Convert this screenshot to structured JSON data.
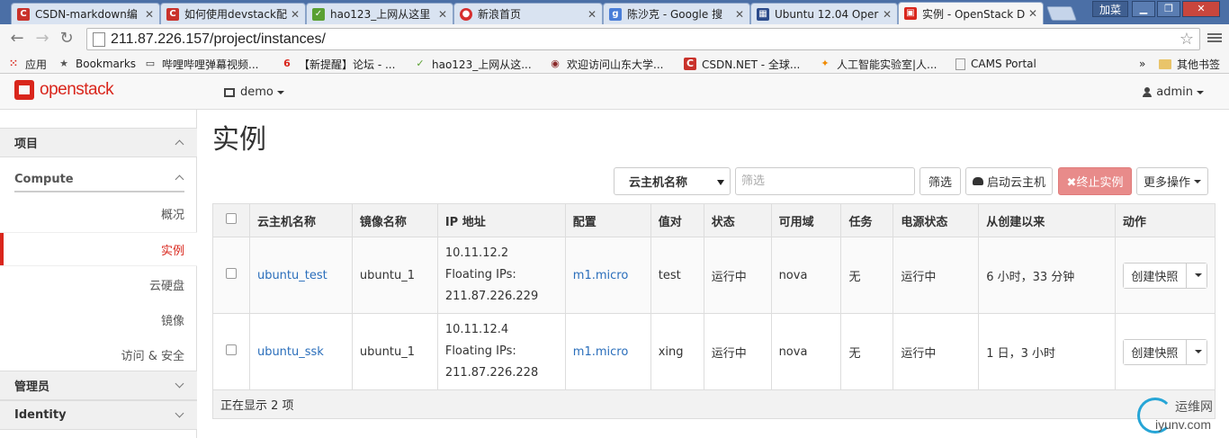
{
  "browser": {
    "tabs": [
      {
        "label": "CSDN-markdown编",
        "icon": "csdn-icon",
        "color": "#c9322b"
      },
      {
        "label": "如何使用devstack配",
        "icon": "csdn-icon",
        "color": "#c9322b"
      },
      {
        "label": "hao123_上网从这里",
        "icon": "hao123-icon",
        "color": "#5aa032"
      },
      {
        "label": "新浪首页",
        "icon": "sina-icon",
        "color": "#d62e2e"
      },
      {
        "label": "陈沙克 - Google 搜",
        "icon": "google-icon",
        "color": "#4a7ed8"
      },
      {
        "label": "Ubuntu 12.04 Oper",
        "icon": "grid-icon",
        "color": "#2b4a8a"
      },
      {
        "label": "实例 - OpenStack D",
        "icon": "openstack-icon",
        "color": "#d9261c"
      }
    ],
    "window_user": "加菜",
    "url": "211.87.226.157/project/instances/",
    "bookmarks": [
      {
        "label": "应用",
        "icon": "apps-icon"
      },
      {
        "label": "Bookmarks",
        "icon": "star-icon"
      },
      {
        "label": "哔哩哔哩弹幕视频...",
        "icon": "bilibili-icon"
      },
      {
        "label": "【新提醒】论坛 - ...",
        "icon": "forum-icon"
      },
      {
        "label": "hao123_上网从这...",
        "icon": "hao123-icon"
      },
      {
        "label": "欢迎访问山东大学...",
        "icon": "university-icon"
      },
      {
        "label": "CSDN.NET - 全球...",
        "icon": "csdn-icon"
      },
      {
        "label": "人工智能实验室|人...",
        "icon": "ai-lab-icon"
      },
      {
        "label": "CAMS Portal",
        "icon": "page-icon"
      }
    ],
    "bookmarks_more": "»",
    "other_bookmarks": "其他书签"
  },
  "header": {
    "logo_text": "openstack",
    "project": "demo",
    "user": "admin"
  },
  "sidebar": {
    "section_project": "项目",
    "compute": "Compute",
    "items": [
      "概况",
      "实例",
      "云硬盘",
      "镜像",
      "访问 & 安全"
    ],
    "active_index": 1,
    "section_admin": "管理员",
    "section_identity": "Identity"
  },
  "main": {
    "title": "实例",
    "filter_field": "云主机名称",
    "filter_placeholder": "筛选",
    "filter_button": "筛选",
    "launch_button": "启动云主机",
    "terminate_button": "✖终止实例",
    "more_actions": "更多操作"
  },
  "table": {
    "headers": [
      "云主机名称",
      "镜像名称",
      "IP 地址",
      "配置",
      "值对",
      "状态",
      "可用域",
      "任务",
      "电源状态",
      "从创建以来",
      "动作"
    ],
    "rows": [
      {
        "name": "ubuntu_test",
        "image": "ubuntu_1",
        "ip_fixed": "10.11.12.2",
        "ip_floating_label": "Floating IPs:",
        "ip_floating": "211.87.226.229",
        "flavor": "m1.micro",
        "keypair": "test",
        "status": "运行中",
        "zone": "nova",
        "task": "无",
        "power": "运行中",
        "age": "6 小时，33 分钟",
        "action": "创建快照"
      },
      {
        "name": "ubuntu_ssk",
        "image": "ubuntu_1",
        "ip_fixed": "10.11.12.4",
        "ip_floating_label": "Floating IPs:",
        "ip_floating": "211.87.226.228",
        "flavor": "m1.micro",
        "keypair": "xing",
        "status": "运行中",
        "zone": "nova",
        "task": "无",
        "power": "运行中",
        "age": "1 日，3 小时",
        "action": "创建快照"
      }
    ],
    "footer": "正在显示 2 项"
  },
  "watermark": {
    "cn": "运维网",
    "en": "iyunv.com"
  }
}
